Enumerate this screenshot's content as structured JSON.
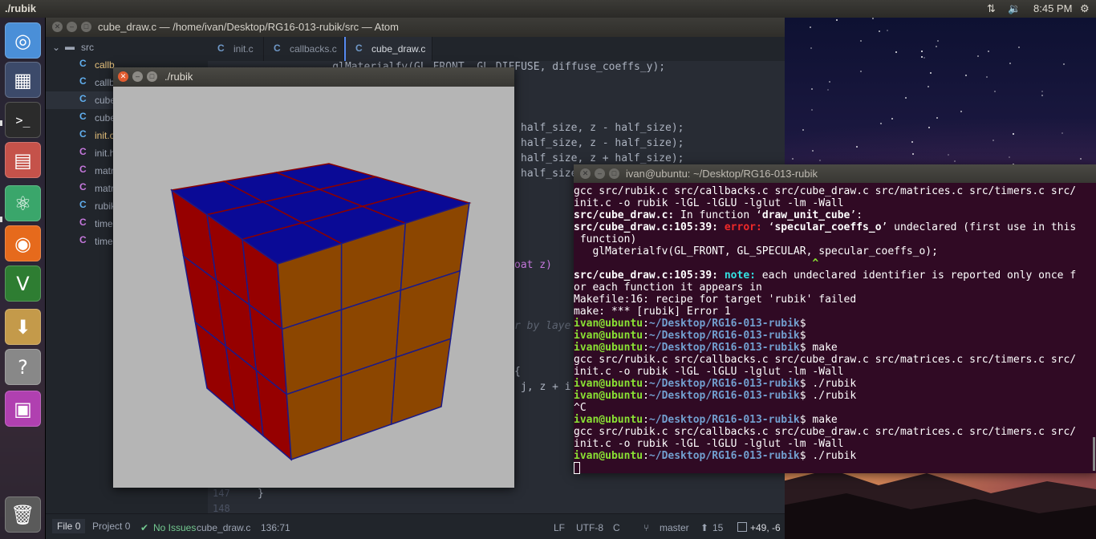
{
  "top_panel": {
    "window_title": "./rubik",
    "icons": [
      "network-icon",
      "volume-icon",
      "gear-icon"
    ],
    "clock": "8:45 PM"
  },
  "launcher": {
    "items": [
      {
        "name": "ubuntu-dash-icon",
        "glyph": "◎",
        "color": "#4a8fd8"
      },
      {
        "name": "workspace-switcher-icon",
        "glyph": "▦",
        "color": "#3c4a6a"
      },
      {
        "name": "terminal-icon",
        "glyph": ">_",
        "color": "#2b2b2b"
      },
      {
        "name": "files-icon",
        "glyph": "▤",
        "color": "#c5524a"
      },
      {
        "name": "atom-icon",
        "glyph": "⚛",
        "color": "#3aa66b"
      },
      {
        "name": "firefox-icon",
        "glyph": "◉",
        "color": "#e66a1c"
      },
      {
        "name": "vim-icon",
        "glyph": "V",
        "color": "#2e7d32"
      },
      {
        "name": "software-install-icon",
        "glyph": "⬇",
        "color": "#c49a4a"
      },
      {
        "name": "help-icon",
        "glyph": "?",
        "color": "#888888"
      },
      {
        "name": "workspace-app-icon",
        "glyph": "▣",
        "color": "#b040b0"
      },
      {
        "name": "trash-icon",
        "glyph": "🗑",
        "color": "#5a5a5a"
      }
    ]
  },
  "atom": {
    "title": "cube_draw.c — /home/ivan/Desktop/RG16-013-rubik/src — Atom",
    "tree": {
      "folder": "src",
      "files": [
        "callb",
        "callb",
        "cube",
        "cube",
        "init.c",
        "init.h",
        "matri",
        "matri",
        "rubik",
        "time",
        "time"
      ]
    },
    "tabs": [
      "init.c",
      "callbacks.c",
      "cube_draw.c"
    ],
    "code_lines": [
      "    glMaterialfv(GL_FRONT, GL_DIFFUSE, diffuse_coeffs_y);",
      "half_size, z - half_size);",
      "half_size, z - half_size);",
      "half_size, z + half_size);",
      "half_size",
      "oat z)",
      "r by laye",
      "{",
      "j, z + i",
      "}"
    ],
    "line_numbers": [
      "147",
      "148"
    ],
    "status": {
      "file": "File",
      "file_count": "0",
      "project": "Project",
      "project_count": "0",
      "issues": "No Issues",
      "filename": "cube_draw.c",
      "cursor": "136:71",
      "eol": "LF",
      "encoding": "UTF-8",
      "grammar": "C",
      "branch": "master",
      "ahead": "15",
      "diff": "+49, -6"
    }
  },
  "rubik_window": {
    "title": "./rubik",
    "faces": {
      "top": "#0a0a96",
      "left": "#960000",
      "right": "#8c4600"
    }
  },
  "terminal": {
    "title": "ivan@ubuntu: ~/Desktop/RG16-013-rubik",
    "user": "ivan@ubuntu",
    "path": "~/Desktop/RG16-013-rubik",
    "gcc_line1": "gcc src/rubik.c src/callbacks.c src/cube_draw.c src/matrices.c src/timers.c src/",
    "gcc_line2": "init.c -o rubik -lGL -lGLU -lglut -lm -Wall",
    "fn_prefix": "src/cube_draw.c:",
    "fn_text": " In function ‘",
    "fn_name": "draw_unit_cube",
    "fn_end": "’:",
    "err_loc": "src/cube_draw.c:105:39:",
    "err_label": "error:",
    "err_q1": " ‘",
    "err_ident": "specular_coeffs_o",
    "err_rest": "’ undeclared (first use in this",
    "err_cont": " function)",
    "src_line": "   glMaterialfv(GL_FRONT, GL_SPECULAR, specular_coeffs_o);",
    "caret": "                                      ^",
    "note_loc": "src/cube_draw.c:105:39:",
    "note_label": "note:",
    "note_rest": " each undeclared identifier is reported only once f",
    "note_cont": "or each function it appears in",
    "make_recipe": "Makefile:16: recipe for target 'rubik' failed",
    "make_error": "make: *** [rubik] Error 1",
    "cmd_make": " make",
    "cmd_run": " ./rubik",
    "ctrl_c": "^C"
  }
}
